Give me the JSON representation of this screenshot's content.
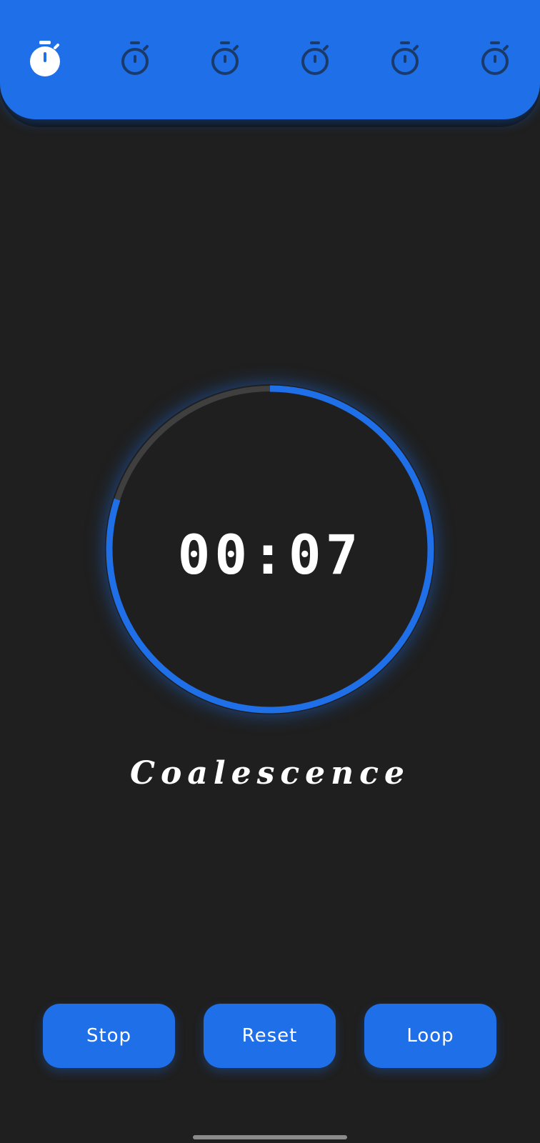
{
  "colors": {
    "accent": "#1f6fe8",
    "background": "#1f1f1f",
    "ring_track": "#3f3f3f",
    "icon_inactive": "#1a3a6a",
    "icon_active": "#ffffff"
  },
  "timer_tabs": [
    {
      "icon": "stopwatch-icon",
      "active": true
    },
    {
      "icon": "stopwatch-icon",
      "active": false
    },
    {
      "icon": "stopwatch-icon",
      "active": false
    },
    {
      "icon": "stopwatch-icon",
      "active": false
    },
    {
      "icon": "stopwatch-icon",
      "active": false
    },
    {
      "icon": "stopwatch-icon",
      "active": false
    }
  ],
  "timer": {
    "time": "00:07",
    "progress_fraction": 0.8,
    "name": "Coalescence"
  },
  "buttons": {
    "stop": "Stop",
    "reset": "Reset",
    "loop": "Loop"
  }
}
